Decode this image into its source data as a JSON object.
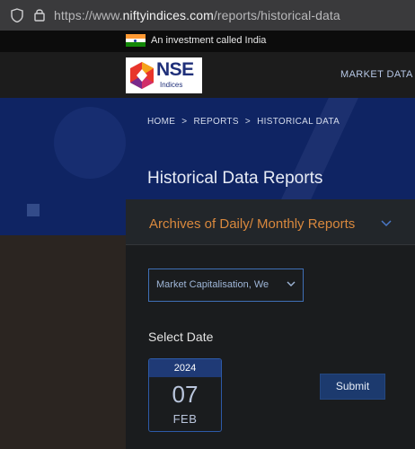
{
  "browser": {
    "url_prefix": "https://www.",
    "url_host": "niftyindices.com",
    "url_path": "/reports/historical-data"
  },
  "top_strip": {
    "tagline": "An investment called India"
  },
  "nav": {
    "logo_text": "NSE",
    "logo_subtext": "Indices",
    "market_data_link": "MARKET DATA"
  },
  "breadcrumb": {
    "items": [
      "HOME",
      ">",
      "REPORTS",
      ">",
      "HISTORICAL DATA"
    ]
  },
  "page": {
    "title": "Historical Data Reports"
  },
  "accordion": {
    "title": "Archives of Daily/ Monthly Reports"
  },
  "form": {
    "report_select_value": "Market Capitalisation, We",
    "select_date_label": "Select Date",
    "date": {
      "year": "2024",
      "day": "07",
      "month": "FEB"
    },
    "submit_label": "Submit"
  },
  "colors": {
    "accent_orange": "#d9883d",
    "hero_blue": "#0f2463",
    "button_blue": "#1c3a6e"
  }
}
